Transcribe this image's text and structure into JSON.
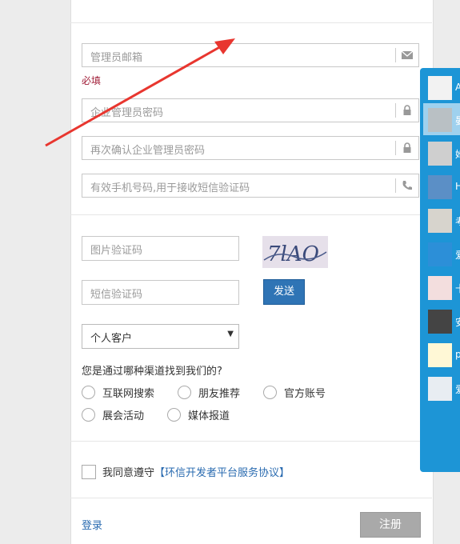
{
  "form": {
    "email_placeholder": "管理员邮箱",
    "required_text": "必填",
    "password_placeholder": "企业管理员密码",
    "confirm_placeholder": "再次确认企业管理员密码",
    "phone_placeholder": "有效手机号码,用于接收短信验证码",
    "image_code_placeholder": "图片验证码",
    "captcha_text": "7lAO",
    "sms_code_placeholder": "短信验证码",
    "send_label": "发送",
    "customer_type": "个人客户",
    "channel_question": "您是通过哪种渠道找到我们的?",
    "channels": [
      "互联网搜索",
      "朋友推荐",
      "官方账号",
      "展会活动",
      "媒体报道"
    ],
    "agree_text": "我同意遵守",
    "agree_link": "【环信开发者平台服务协议】",
    "login_label": "登录",
    "register_label": "注册"
  },
  "chat_panel": {
    "contacts": [
      {
        "name": "A",
        "icon": "android-avatar"
      },
      {
        "name": "晏",
        "icon": "photo-avatar"
      },
      {
        "name": "她",
        "icon": "photo-avatar"
      },
      {
        "name": "H",
        "icon": "photo-avatar"
      },
      {
        "name": "考",
        "icon": "photo-avatar"
      },
      {
        "name": "爱",
        "icon": "logo-avatar"
      },
      {
        "name": "十",
        "icon": "anime-avatar"
      },
      {
        "name": "安",
        "icon": "photo-avatar"
      },
      {
        "name": "p",
        "icon": "bulb-avatar"
      },
      {
        "name": "爱",
        "icon": "person-avatar"
      }
    ]
  },
  "colors": {
    "accent": "#2f74b5",
    "required": "#a2203a",
    "panel": "#1d95d6",
    "annotation_arrow": "#e8362f"
  }
}
